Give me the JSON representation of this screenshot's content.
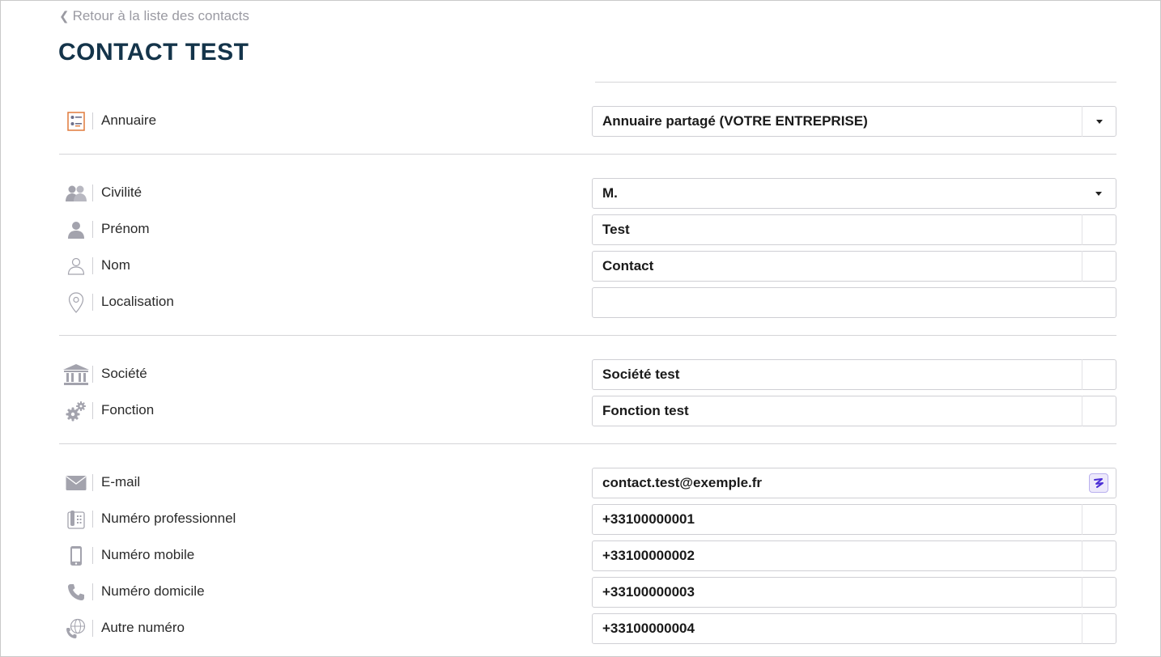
{
  "nav": {
    "back_label": "Retour à la liste des contacts"
  },
  "page": {
    "title": "CONTACT TEST"
  },
  "sections": {
    "directory": {
      "label": "Annuaire",
      "icon": "directory-card-icon",
      "value": "Annuaire partagé (VOTRE ENTREPRISE)"
    },
    "identity": {
      "civility": {
        "label": "Civilité",
        "icon": "people-icon",
        "value": "M."
      },
      "firstname": {
        "label": "Prénom",
        "icon": "person-icon",
        "value": "Test"
      },
      "lastname": {
        "label": "Nom",
        "icon": "person-outline-icon",
        "value": "Contact"
      },
      "location": {
        "label": "Localisation",
        "icon": "map-pin-icon",
        "value": ""
      }
    },
    "company": {
      "company": {
        "label": "Société",
        "icon": "bank-building-icon",
        "value": "Société test"
      },
      "function": {
        "label": "Fonction",
        "icon": "gears-icon",
        "value": "Fonction test"
      }
    },
    "contact": {
      "email": {
        "label": "E-mail",
        "icon": "envelope-icon",
        "value": "contact.test@exemple.fr"
      },
      "work": {
        "label": "Numéro professionnel",
        "icon": "desk-phone-icon",
        "value": "+33100000001"
      },
      "mobile": {
        "label": "Numéro mobile",
        "icon": "mobile-phone-icon",
        "value": "+33100000002"
      },
      "home": {
        "label": "Numéro domicile",
        "icon": "phone-handset-icon",
        "value": "+33100000003"
      },
      "other": {
        "label": "Autre numéro",
        "icon": "globe-phone-icon",
        "value": "+33100000004"
      }
    }
  },
  "colors": {
    "title": "#14344a",
    "muted": "#9a9aa2",
    "icon": "#a3a3ad",
    "border": "#cfcfd4",
    "accent": "#4b2fd6"
  }
}
